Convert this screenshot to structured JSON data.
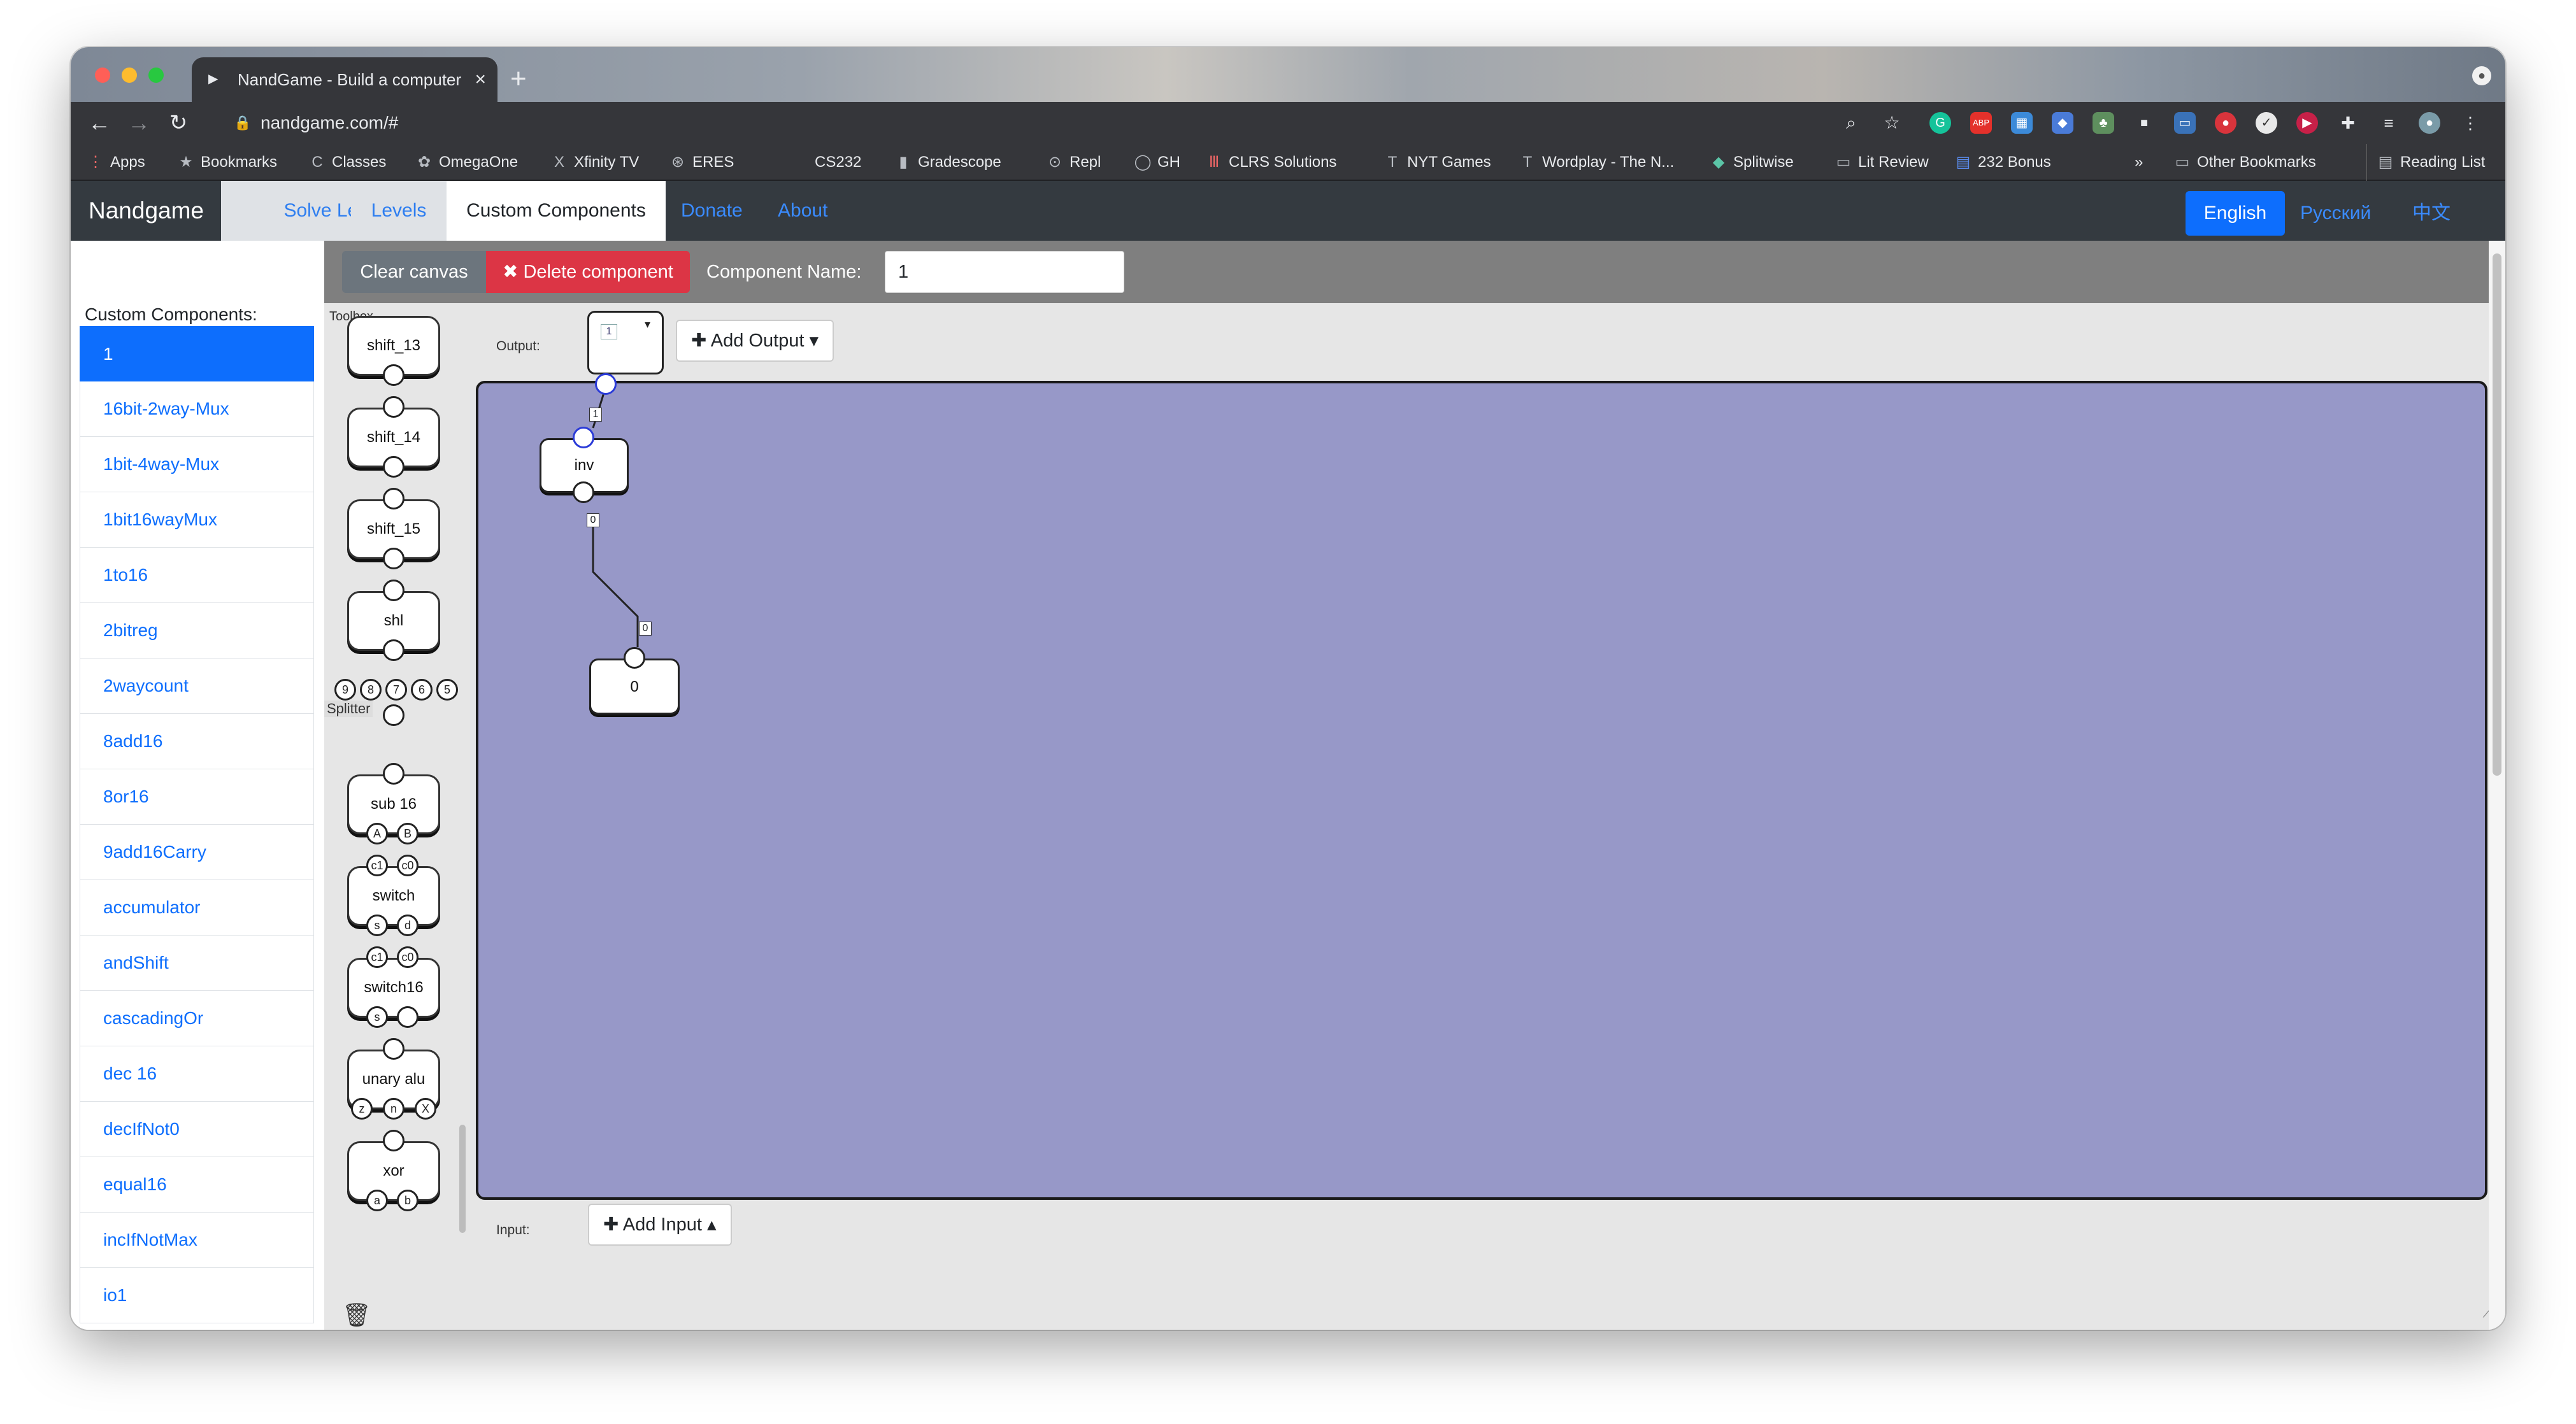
{
  "browser": {
    "tab_title": "NandGame - Build a computer",
    "url": "nandgame.com/#",
    "bookmarks": [
      "Apps",
      "Bookmarks",
      "Classes",
      "OmegaOne",
      "Xfinity TV",
      "ERES",
      "CS232",
      "Gradescope",
      "Repl",
      "GH",
      "CLRS Solutions",
      "NYT Games",
      "Wordplay - The N...",
      "Splitwise",
      "Lit Review",
      "232 Bonus"
    ],
    "other_bookmarks": "Other Bookmarks",
    "reading_list": "Reading List",
    "more": "»"
  },
  "nav": {
    "brand": "Nandgame",
    "tabs": [
      "Solve Level",
      "Levels",
      "Custom Components"
    ],
    "links": [
      "Donate",
      "About"
    ],
    "languages": [
      "English",
      "Русский",
      "中文"
    ]
  },
  "controls": {
    "clear_label": "Clear canvas",
    "delete_label": "✖ Delete component",
    "name_label": "Component Name:",
    "name_value": "1"
  },
  "sidebar": {
    "heading": "Custom Components:",
    "items": [
      "1",
      "16bit-2way-Mux",
      "1bit-4way-Mux",
      "1bit16wayMux",
      "1to16",
      "2bitreg",
      "2waycount",
      "8add16",
      "8or16",
      "9add16Carry",
      "accumulator",
      "andShift",
      "cascadingOr",
      "dec 16",
      "decIfNot0",
      "equal16",
      "incIfNotMax",
      "io1"
    ]
  },
  "toolbox": {
    "label": "Toolbox",
    "components": [
      "shift_13",
      "shift_14",
      "shift_15",
      "shl",
      "sub 16",
      "switch",
      "switch16",
      "unary alu",
      "xor"
    ],
    "splitter_label": "Splitter",
    "splitter_ports": [
      "9",
      "8",
      "7",
      "6",
      "5"
    ],
    "sub16_ports": [
      "A",
      "B"
    ],
    "switch_top_ports": [
      "c1",
      "c0"
    ],
    "switch_bottom_ports": [
      "s",
      "d"
    ],
    "unary_ports": [
      "z",
      "n",
      "X"
    ],
    "xor_ports": [
      "a",
      "b"
    ]
  },
  "canvas": {
    "output_label": "Output:",
    "output_value": "1",
    "add_output": "✚ Add Output ▾",
    "input_label": "Input:",
    "add_input": "✚ Add Input ▴",
    "inv_label": "inv",
    "const_label": "0",
    "wire_top_value": "1",
    "wire_mid_value": "0",
    "wire_low_value": "0",
    "board_color": "#9798c8"
  },
  "colors": {
    "primary": "#0d6efd",
    "danger": "#dc3545",
    "secondary": "#6c757d",
    "navbar": "#343a40"
  }
}
